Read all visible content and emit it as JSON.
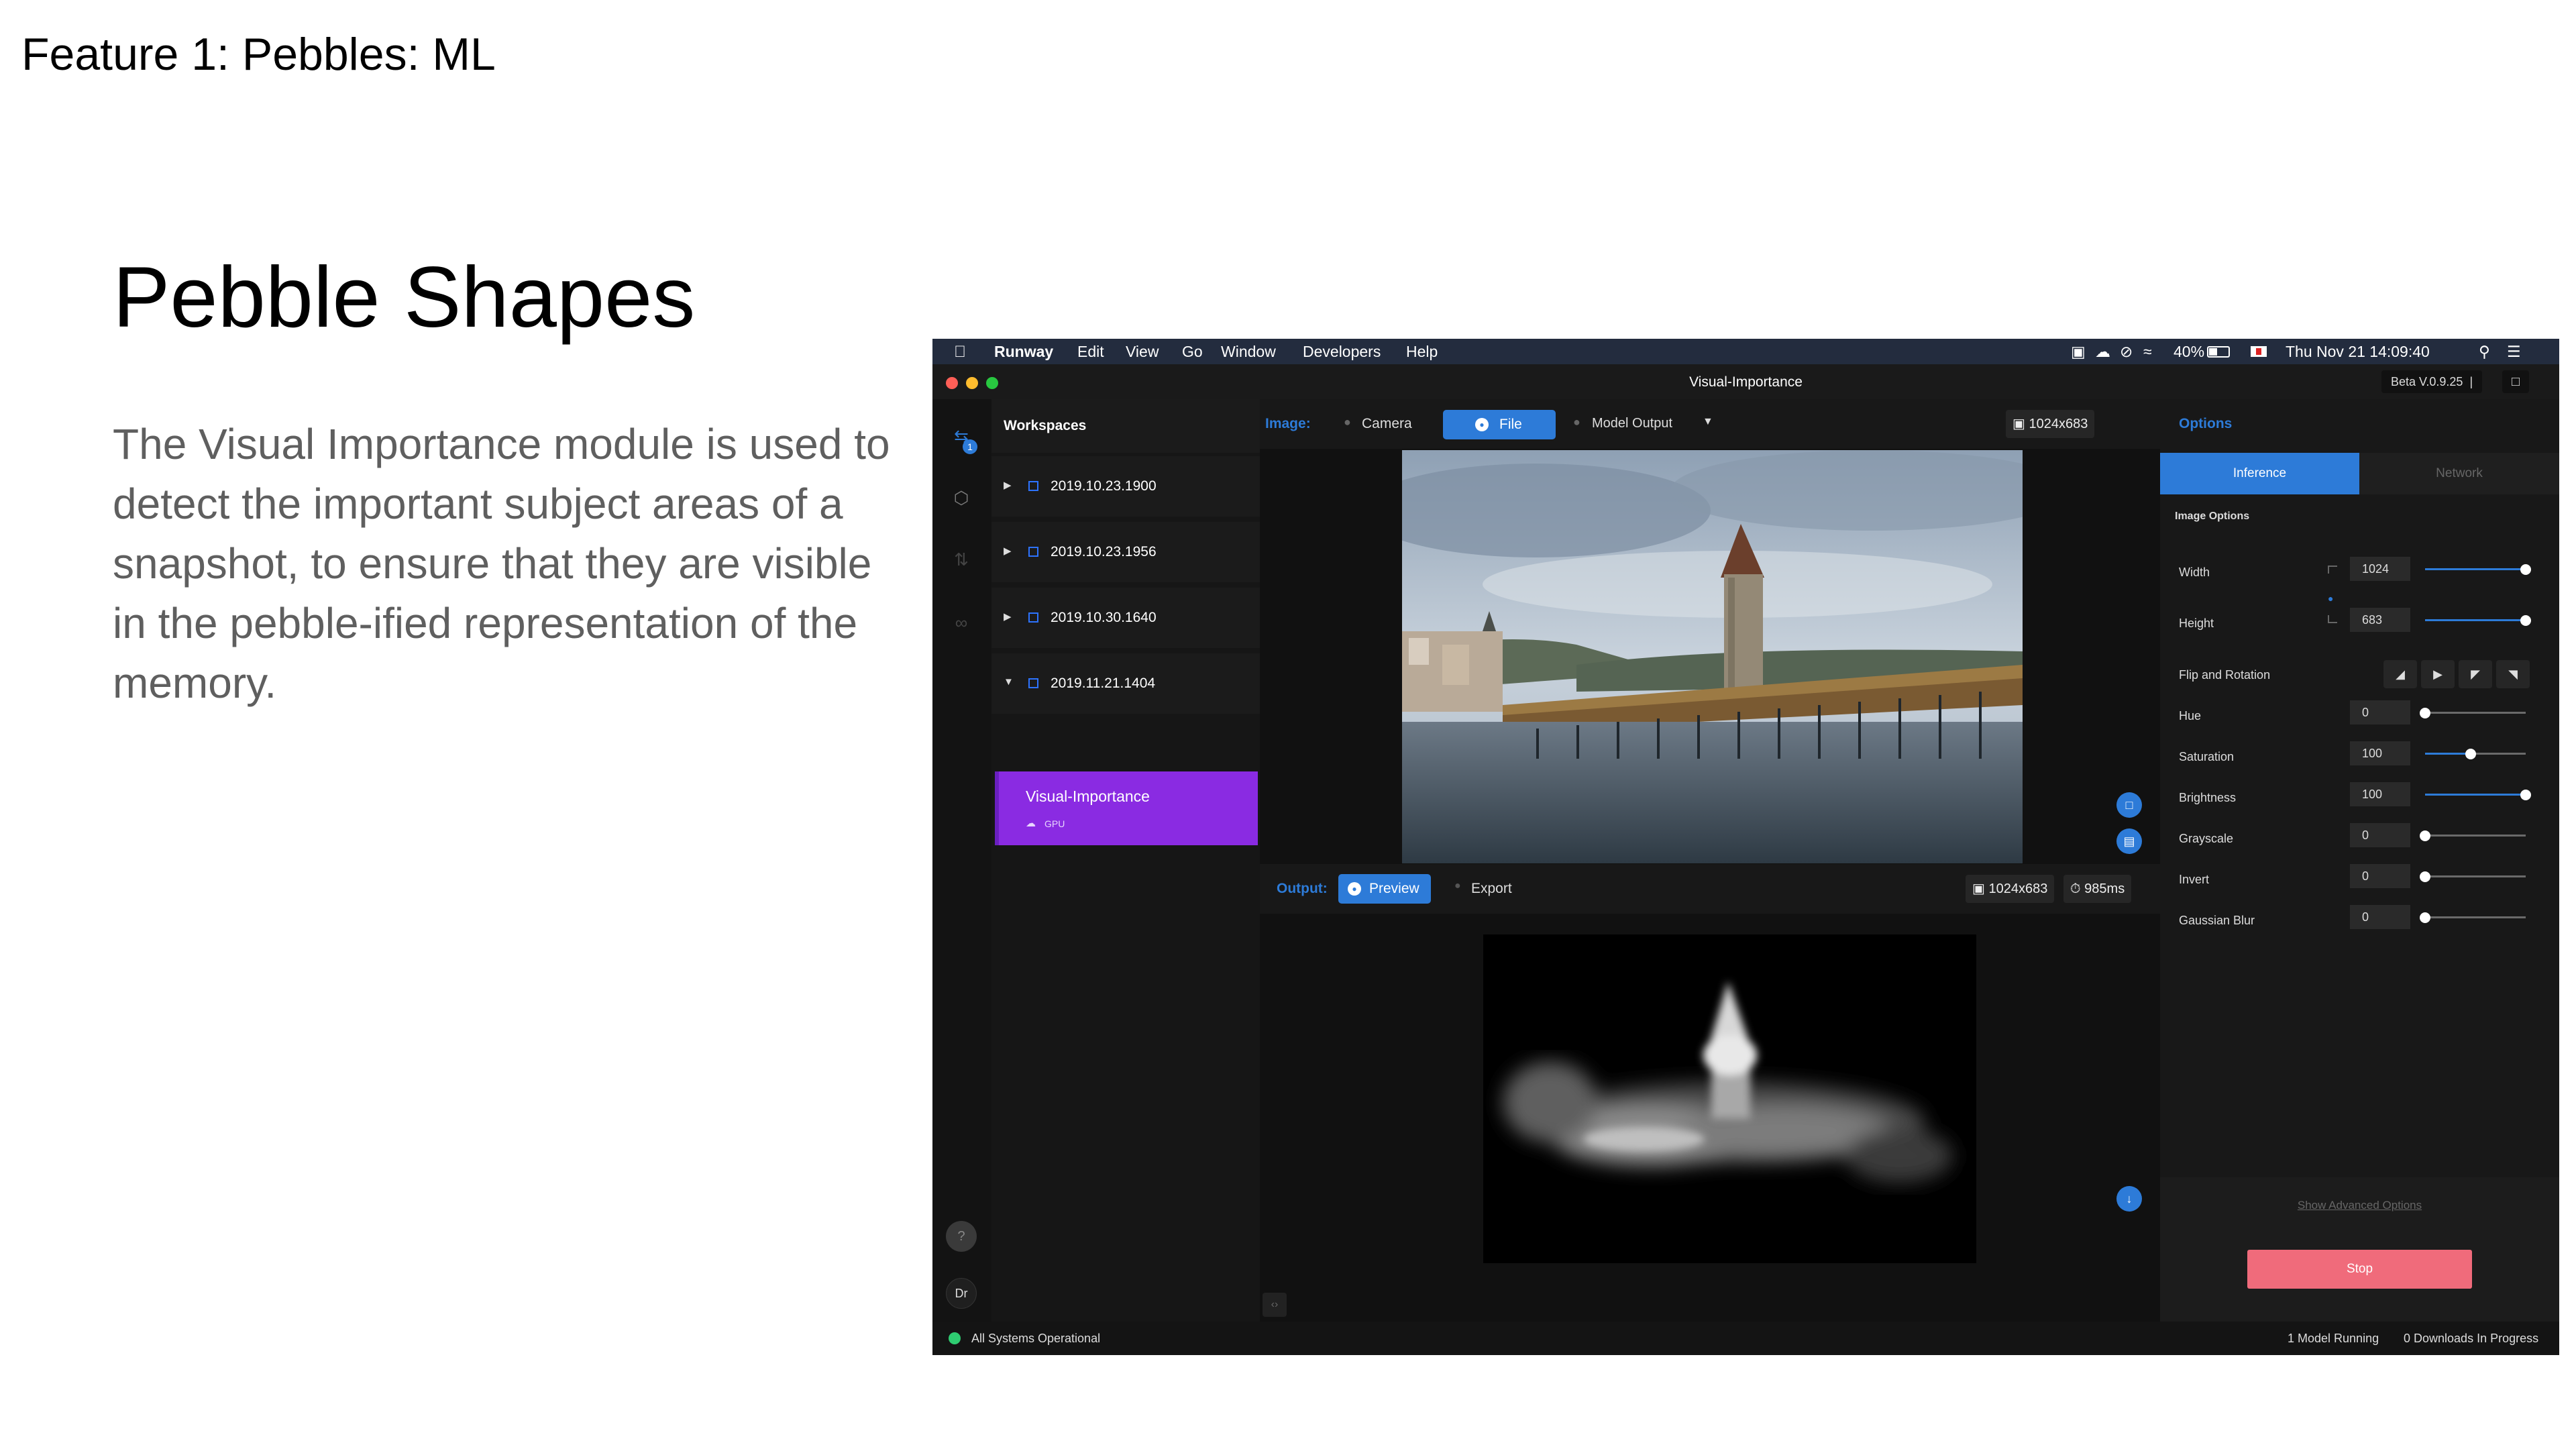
{
  "slide": {
    "feature_title": "Feature 1: Pebbles: ML",
    "title": "Pebble Shapes",
    "body": "The Visual Importance module is used to detect the important subject areas of a snapshot, to ensure that they are visible in the pebble-ified representation of the memory."
  },
  "menubar": {
    "app_name": "Runway",
    "items": [
      "Edit",
      "View",
      "Go",
      "Window",
      "Developers",
      "Help"
    ],
    "battery": "40%",
    "clock": "Thu Nov 21  14:09:40"
  },
  "window": {
    "title": "Visual-Importance",
    "version": "Beta V.0.9.25"
  },
  "sidebar": {
    "badge": "1",
    "help": "?",
    "avatar": "Dr"
  },
  "workspaces": {
    "header": "Workspaces",
    "items": [
      "2019.10.23.1900",
      "2019.10.23.1956",
      "2019.10.30.1640",
      "2019.11.21.1404"
    ],
    "active_model": {
      "name": "Visual-Importance",
      "tag": "GPU"
    }
  },
  "image_bar": {
    "label": "Image:",
    "camera": "Camera",
    "file": "File",
    "model_output": "Model Output",
    "dimensions": "1024x683"
  },
  "output_bar": {
    "label": "Output:",
    "preview": "Preview",
    "export": "Export",
    "dimensions": "1024x683",
    "time": "985ms"
  },
  "options": {
    "title": "Options",
    "tabs": [
      "Inference",
      "Network"
    ],
    "section": "Image Options",
    "width": {
      "label": "Width",
      "value": "1024",
      "fraction": 1.0
    },
    "height": {
      "label": "Height",
      "value": "683",
      "fraction": 1.0
    },
    "flip_label": "Flip and Rotation",
    "sliders": [
      {
        "label": "Hue",
        "value": "0",
        "fraction": 0.0
      },
      {
        "label": "Saturation",
        "value": "100",
        "fraction": 0.45
      },
      {
        "label": "Brightness",
        "value": "100",
        "fraction": 1.0
      },
      {
        "label": "Grayscale",
        "value": "0",
        "fraction": 0.0
      },
      {
        "label": "Invert",
        "value": "0",
        "fraction": 0.0
      },
      {
        "label": "Gaussian Blur",
        "value": "0",
        "fraction": 0.0
      }
    ],
    "advanced_link": "Show Advanced Options",
    "stop": "Stop"
  },
  "status": {
    "left": "All Systems Operational",
    "models": "1 Model Running",
    "downloads": "0 Downloads In Progress"
  },
  "colors": {
    "accent_blue": "#2d7bd8",
    "active_purple": "#8a2be2",
    "stop_red": "#f06b7b",
    "ok_green": "#2ecc71"
  }
}
